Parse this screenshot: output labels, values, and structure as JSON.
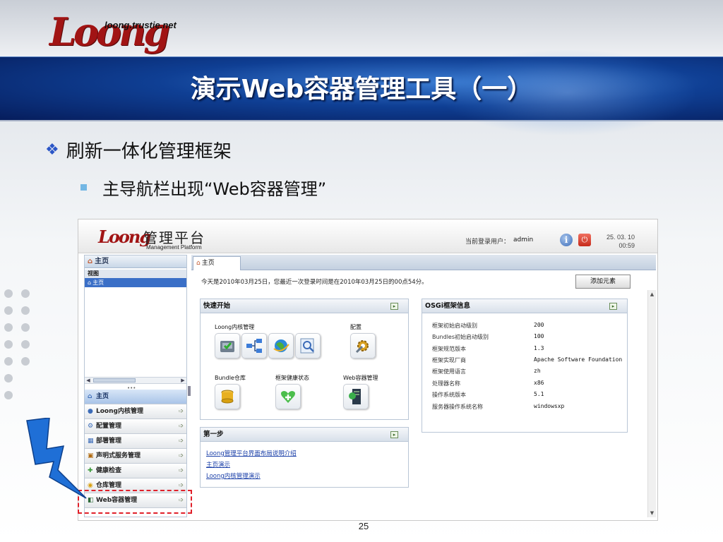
{
  "slide": {
    "logo_url": "loong.trustie.net",
    "logo_text": "Loong",
    "title": "演示Web容器管理工具（一）",
    "bullet1": "刷新一体化管理框架",
    "bullet2": "主导航栏出现“Web容器管理”",
    "page_number": "25"
  },
  "colors": {
    "title_band": "#0f3f94",
    "highlight": "#e0202a",
    "link": "#1a3fa8",
    "bolt": "#1f6fd6"
  },
  "app": {
    "logo_text": "Loong",
    "title": "管理平台",
    "subtitle": "Management Platform",
    "user_label": "当前登录用户：",
    "user_name": "admin",
    "info_icon": "i",
    "date": "25. 03. 10",
    "time": "00:59"
  },
  "left_panel": {
    "home_label": "主页",
    "tree_header": "视图",
    "tree_item": "主页",
    "splitter_glyph": "•••",
    "nav_items": [
      {
        "label": "主页",
        "icon": "home-icon"
      },
      {
        "label": "Loong内核管理",
        "icon": "kernel-icon"
      },
      {
        "label": "配置管理",
        "icon": "config-icon"
      },
      {
        "label": "部署管理",
        "icon": "deploy-icon"
      },
      {
        "label": "声明式服务管理",
        "icon": "service-icon"
      },
      {
        "label": "健康检查",
        "icon": "health-icon"
      },
      {
        "label": "仓库管理",
        "icon": "repo-icon"
      },
      {
        "label": "Web容器管理",
        "icon": "web-container-icon"
      }
    ]
  },
  "main": {
    "tab_label": "主页",
    "welcome": "今天是2010年03月25日，您最近一次登录时间是在2010年03月25日的00点54分。",
    "add_button": "添加元素",
    "quick_start": {
      "title": "快速开始",
      "loong_kernel_label": "Loong内核管理",
      "config_label": "配置",
      "bundle_label": "Bundle仓库",
      "health_label": "框架健康状态",
      "web_label": "Web容器管理"
    },
    "osgi": {
      "title": "OSGi框架信息",
      "rows": [
        {
          "label": "框架初始启动级别",
          "value": "200"
        },
        {
          "label": "Bundles初始启动级别",
          "value": "100"
        },
        {
          "label": "框架规范版本",
          "value": "1.3"
        },
        {
          "label": "框架实现厂商",
          "value": "Apache Software Foundation"
        },
        {
          "label": "框架使用语言",
          "value": "zh"
        },
        {
          "label": "处理器名称",
          "value": "x86"
        },
        {
          "label": "操作系统版本",
          "value": "5.1"
        },
        {
          "label": "服务器操作系统名称",
          "value": "windowsxp"
        }
      ]
    },
    "first_step": {
      "title": "第一步",
      "links": [
        "Loong管理平台界面布局说明介绍",
        "主页演示",
        "Loong内核管理演示"
      ]
    }
  }
}
